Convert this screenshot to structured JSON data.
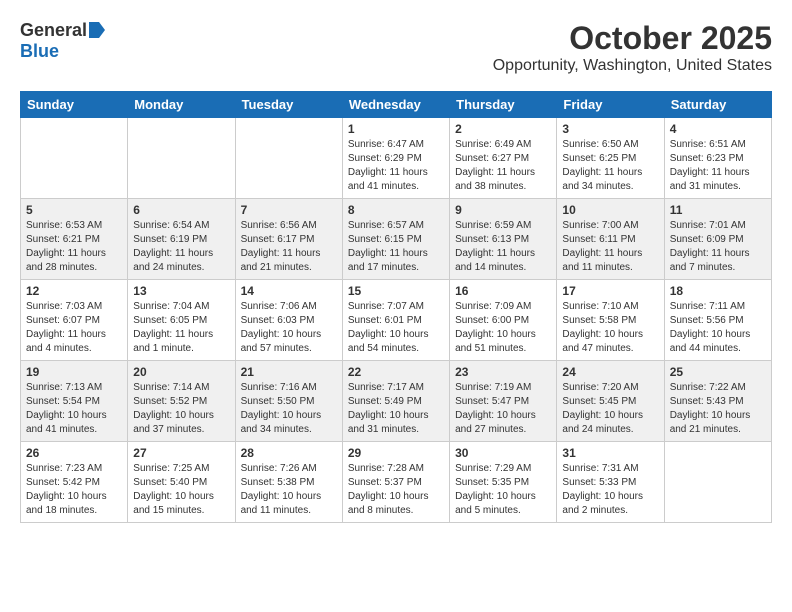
{
  "logo": {
    "general": "General",
    "blue": "Blue"
  },
  "title": "October 2025",
  "subtitle": "Opportunity, Washington, United States",
  "days_of_week": [
    "Sunday",
    "Monday",
    "Tuesday",
    "Wednesday",
    "Thursday",
    "Friday",
    "Saturday"
  ],
  "weeks": [
    [
      {
        "day": "",
        "info": ""
      },
      {
        "day": "",
        "info": ""
      },
      {
        "day": "",
        "info": ""
      },
      {
        "day": "1",
        "info": "Sunrise: 6:47 AM\nSunset: 6:29 PM\nDaylight: 11 hours\nand 41 minutes."
      },
      {
        "day": "2",
        "info": "Sunrise: 6:49 AM\nSunset: 6:27 PM\nDaylight: 11 hours\nand 38 minutes."
      },
      {
        "day": "3",
        "info": "Sunrise: 6:50 AM\nSunset: 6:25 PM\nDaylight: 11 hours\nand 34 minutes."
      },
      {
        "day": "4",
        "info": "Sunrise: 6:51 AM\nSunset: 6:23 PM\nDaylight: 11 hours\nand 31 minutes."
      }
    ],
    [
      {
        "day": "5",
        "info": "Sunrise: 6:53 AM\nSunset: 6:21 PM\nDaylight: 11 hours\nand 28 minutes."
      },
      {
        "day": "6",
        "info": "Sunrise: 6:54 AM\nSunset: 6:19 PM\nDaylight: 11 hours\nand 24 minutes."
      },
      {
        "day": "7",
        "info": "Sunrise: 6:56 AM\nSunset: 6:17 PM\nDaylight: 11 hours\nand 21 minutes."
      },
      {
        "day": "8",
        "info": "Sunrise: 6:57 AM\nSunset: 6:15 PM\nDaylight: 11 hours\nand 17 minutes."
      },
      {
        "day": "9",
        "info": "Sunrise: 6:59 AM\nSunset: 6:13 PM\nDaylight: 11 hours\nand 14 minutes."
      },
      {
        "day": "10",
        "info": "Sunrise: 7:00 AM\nSunset: 6:11 PM\nDaylight: 11 hours\nand 11 minutes."
      },
      {
        "day": "11",
        "info": "Sunrise: 7:01 AM\nSunset: 6:09 PM\nDaylight: 11 hours\nand 7 minutes."
      }
    ],
    [
      {
        "day": "12",
        "info": "Sunrise: 7:03 AM\nSunset: 6:07 PM\nDaylight: 11 hours\nand 4 minutes."
      },
      {
        "day": "13",
        "info": "Sunrise: 7:04 AM\nSunset: 6:05 PM\nDaylight: 11 hours\nand 1 minute."
      },
      {
        "day": "14",
        "info": "Sunrise: 7:06 AM\nSunset: 6:03 PM\nDaylight: 10 hours\nand 57 minutes."
      },
      {
        "day": "15",
        "info": "Sunrise: 7:07 AM\nSunset: 6:01 PM\nDaylight: 10 hours\nand 54 minutes."
      },
      {
        "day": "16",
        "info": "Sunrise: 7:09 AM\nSunset: 6:00 PM\nDaylight: 10 hours\nand 51 minutes."
      },
      {
        "day": "17",
        "info": "Sunrise: 7:10 AM\nSunset: 5:58 PM\nDaylight: 10 hours\nand 47 minutes."
      },
      {
        "day": "18",
        "info": "Sunrise: 7:11 AM\nSunset: 5:56 PM\nDaylight: 10 hours\nand 44 minutes."
      }
    ],
    [
      {
        "day": "19",
        "info": "Sunrise: 7:13 AM\nSunset: 5:54 PM\nDaylight: 10 hours\nand 41 minutes."
      },
      {
        "day": "20",
        "info": "Sunrise: 7:14 AM\nSunset: 5:52 PM\nDaylight: 10 hours\nand 37 minutes."
      },
      {
        "day": "21",
        "info": "Sunrise: 7:16 AM\nSunset: 5:50 PM\nDaylight: 10 hours\nand 34 minutes."
      },
      {
        "day": "22",
        "info": "Sunrise: 7:17 AM\nSunset: 5:49 PM\nDaylight: 10 hours\nand 31 minutes."
      },
      {
        "day": "23",
        "info": "Sunrise: 7:19 AM\nSunset: 5:47 PM\nDaylight: 10 hours\nand 27 minutes."
      },
      {
        "day": "24",
        "info": "Sunrise: 7:20 AM\nSunset: 5:45 PM\nDaylight: 10 hours\nand 24 minutes."
      },
      {
        "day": "25",
        "info": "Sunrise: 7:22 AM\nSunset: 5:43 PM\nDaylight: 10 hours\nand 21 minutes."
      }
    ],
    [
      {
        "day": "26",
        "info": "Sunrise: 7:23 AM\nSunset: 5:42 PM\nDaylight: 10 hours\nand 18 minutes."
      },
      {
        "day": "27",
        "info": "Sunrise: 7:25 AM\nSunset: 5:40 PM\nDaylight: 10 hours\nand 15 minutes."
      },
      {
        "day": "28",
        "info": "Sunrise: 7:26 AM\nSunset: 5:38 PM\nDaylight: 10 hours\nand 11 minutes."
      },
      {
        "day": "29",
        "info": "Sunrise: 7:28 AM\nSunset: 5:37 PM\nDaylight: 10 hours\nand 8 minutes."
      },
      {
        "day": "30",
        "info": "Sunrise: 7:29 AM\nSunset: 5:35 PM\nDaylight: 10 hours\nand 5 minutes."
      },
      {
        "day": "31",
        "info": "Sunrise: 7:31 AM\nSunset: 5:33 PM\nDaylight: 10 hours\nand 2 minutes."
      },
      {
        "day": "",
        "info": ""
      }
    ]
  ]
}
